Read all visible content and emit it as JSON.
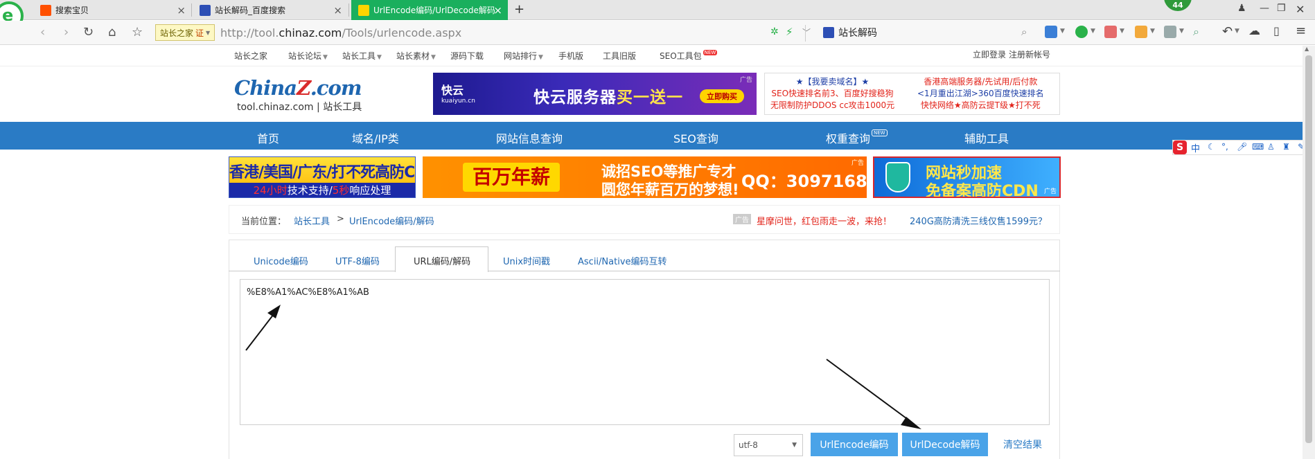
{
  "browser": {
    "tabs": [
      {
        "title": "搜索宝贝",
        "favicon_color": "#ff5000"
      },
      {
        "title": "站长解码_百度搜索",
        "favicon_color": "#2d4fb5"
      },
      {
        "title": "UrlEncode编码/UrlDecode解码",
        "favicon_color": "#ffd400"
      }
    ],
    "new_tab_glyph": "+",
    "close_glyph": "×",
    "badge_count": "44",
    "site_badge": "站长之家",
    "site_badge_cert": "证",
    "url_prefix": "http://tool.",
    "url_domain": "chinaz.com",
    "url_path": "/Tools/urlencode.aspx",
    "search_text": "站长解码",
    "accent_color": "#1aaf5d"
  },
  "site": {
    "top_links": [
      "站长之家",
      "站长论坛",
      "站长工具",
      "站长素材",
      "源码下载",
      "网站排行",
      "手机版",
      "工具旧版",
      "SEO工具包"
    ],
    "new_tag": "NEW",
    "login": "立即登录",
    "register": "注册新帐号",
    "logo_left": "China",
    "logo_z": "Z",
    "logo_right": ".com",
    "logo_sub": "tool.chinaz.com | 站长工具",
    "ad_kuaiyun": {
      "brand": "快云",
      "brand_sub": "kuaiyun.cn",
      "title_a": "快云服务器",
      "title_b": "买一送一",
      "buy": "立即购买",
      "tag": "广告"
    },
    "ad_text": {
      "left": [
        "★【我要卖域名】★",
        "SEO快速排名前3、百度好搜稳狗",
        "无限制防护DDOS cc攻击1000元"
      ],
      "right": [
        "香港高端服务器/先试用/后付款",
        "<1月重出江湖>360百度快速排名",
        "快快网络★高防云提T级★打不死"
      ]
    },
    "main_nav": [
      "首页",
      "域名/IP类",
      "网站信息查询",
      "SEO查询",
      "权重查询",
      "辅助工具"
    ],
    "banner1": {
      "line1": "香港/美国/广东/打不死高防CDN",
      "line2_a": "24小时",
      "line2_b": "技术支持/",
      "line2_c": "5秒",
      "line2_d": "响应处理"
    },
    "banner2": {
      "big": "百万年薪",
      "line1": "诚招SEO等推广专才",
      "line2": "圆您年薪百万的梦想!",
      "qq": "QQ：3097168",
      "tag": "广告"
    },
    "banner3": {
      "line1": "网站秒加速",
      "line2": "免备案高防CDN",
      "tag": "广告"
    },
    "breadcrumb": {
      "label": "当前位置：",
      "level1": "站长工具",
      "sep": ">",
      "level2": "UrlEncode编码/解码",
      "ad_tag": "广告",
      "promo_red": "星摩问世，红包雨走一波，来抢！",
      "promo_blue": "240G高防清洗三线仅售1599元？"
    }
  },
  "tool": {
    "tabs": [
      "Unicode编码",
      "UTF-8编码",
      "URL编码/解码",
      "Unix时间戳",
      "Ascii/Native编码互转"
    ],
    "active_tab_index": 2,
    "input_value": "%E8%A1%AC%E8%A1%AB",
    "encoding_selected": "utf-8",
    "btn_encode": "UrlEncode编码",
    "btn_decode": "UrlDecode解码",
    "btn_clear": "清空结果",
    "button_color": "#4aa3e8"
  },
  "ime": {
    "logo": "S",
    "mode": "中"
  }
}
